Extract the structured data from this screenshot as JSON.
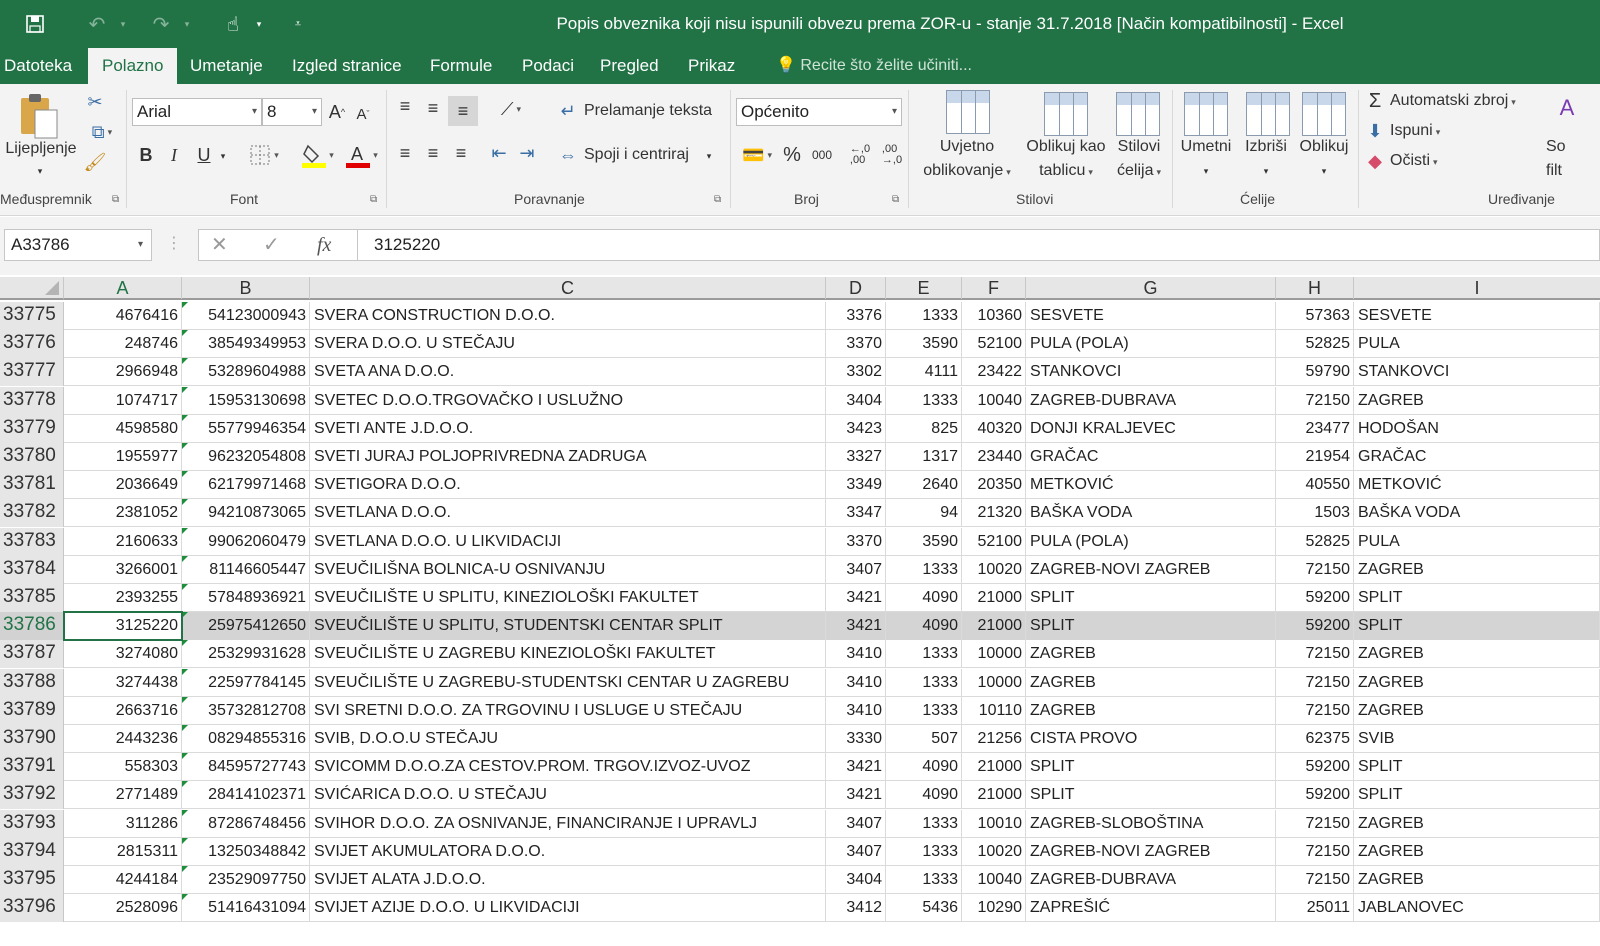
{
  "window": {
    "title": "Popis obveznika koji nisu ispunili obvezu prema ZOR-u - stanje 31.7.2018  [Način kompatibilnosti] - Excel"
  },
  "quick_access": {
    "icons": [
      "save-icon",
      "undo-icon",
      "redo-icon",
      "touch-mode-icon",
      "customize-icon"
    ]
  },
  "tabs": [
    "Datoteka",
    "Polazno",
    "Umetanje",
    "Izgled stranice",
    "Formule",
    "Podaci",
    "Pregled",
    "Prikaz"
  ],
  "active_tab": "Polazno",
  "tell_me": "Recite što želite učiniti...",
  "ribbon": {
    "clipboard": {
      "paste_label": "Lijepljenje",
      "group": "Međuspremnik"
    },
    "font": {
      "name": "Arial",
      "size": "8",
      "group": "Font",
      "bold": "B",
      "italic": "I",
      "underline": "U"
    },
    "alignment": {
      "wrap": "Prelamanje teksta",
      "merge": "Spoji i centriraj",
      "group": "Poravnanje"
    },
    "number": {
      "format": "Općenito",
      "percent": "%",
      "thousands": "000",
      "group": "Broj"
    },
    "styles": {
      "conditional_1": "Uvjetno",
      "conditional_2": "oblikovanje",
      "table_1": "Oblikuj kao",
      "table_2": "tablicu",
      "cell_1": "Stilovi",
      "cell_2": "ćelija",
      "group": "Stilovi"
    },
    "cells": {
      "insert": "Umetni",
      "delete": "Izbriši",
      "format": "Oblikuj",
      "group": "Ćelije"
    },
    "editing": {
      "autosum": "Automatski zbroj",
      "fill": "Ispuni",
      "clear": "Očisti",
      "sort_1": "So",
      "sort_2": "filt",
      "group": "Uređivanje"
    }
  },
  "formula_bar": {
    "name_box": "A33786",
    "value": "3125220",
    "fx": "fx"
  },
  "columns": [
    "A",
    "B",
    "C",
    "D",
    "E",
    "F",
    "G",
    "H",
    "I"
  ],
  "selected_row": "33786",
  "rows": [
    {
      "n": "33775",
      "a": "4676416",
      "b": "54123000943",
      "c": "SVERA CONSTRUCTION D.O.O.",
      "d": "3376",
      "e": "1333",
      "f": "10360",
      "g": "SESVETE",
      "h": "57363",
      "i": "SESVETE"
    },
    {
      "n": "33776",
      "a": "248746",
      "b": "38549349953",
      "c": "SVERA D.O.O. U STEČAJU",
      "d": "3370",
      "e": "3590",
      "f": "52100",
      "g": "PULA (POLA)",
      "h": "52825",
      "i": "PULA"
    },
    {
      "n": "33777",
      "a": "2966948",
      "b": "53289604988",
      "c": "SVETA ANA D.O.O.",
      "d": "3302",
      "e": "4111",
      "f": "23422",
      "g": "STANKOVCI",
      "h": "59790",
      "i": "STANKOVCI"
    },
    {
      "n": "33778",
      "a": "1074717",
      "b": "15953130698",
      "c": "SVETEC D.O.O.TRGOVAČKO I USLUŽNO",
      "d": "3404",
      "e": "1333",
      "f": "10040",
      "g": "ZAGREB-DUBRAVA",
      "h": "72150",
      "i": "ZAGREB"
    },
    {
      "n": "33779",
      "a": "4598580",
      "b": "55779946354",
      "c": "SVETI ANTE J.D.O.O.",
      "d": "3423",
      "e": "825",
      "f": "40320",
      "g": "DONJI KRALJEVEC",
      "h": "23477",
      "i": "HODOŠAN"
    },
    {
      "n": "33780",
      "a": "1955977",
      "b": "96232054808",
      "c": "SVETI JURAJ POLJOPRIVREDNA ZADRUGA",
      "d": "3327",
      "e": "1317",
      "f": "23440",
      "g": "GRAČAC",
      "h": "21954",
      "i": "GRAČAC"
    },
    {
      "n": "33781",
      "a": "2036649",
      "b": "62179971468",
      "c": "SVETIGORA D.O.O.",
      "d": "3349",
      "e": "2640",
      "f": "20350",
      "g": "METKOVIĆ",
      "h": "40550",
      "i": "METKOVIĆ"
    },
    {
      "n": "33782",
      "a": "2381052",
      "b": "94210873065",
      "c": "SVETLANA D.O.O.",
      "d": "3347",
      "e": "94",
      "f": "21320",
      "g": "BAŠKA VODA",
      "h": "1503",
      "i": "BAŠKA VODA"
    },
    {
      "n": "33783",
      "a": "2160633",
      "b": "99062060479",
      "c": "SVETLANA D.O.O. U LIKVIDACIJI",
      "d": "3370",
      "e": "3590",
      "f": "52100",
      "g": "PULA (POLA)",
      "h": "52825",
      "i": "PULA"
    },
    {
      "n": "33784",
      "a": "3266001",
      "b": "81146605447",
      "c": "SVEUČILIŠNA BOLNICA-U OSNIVANJU",
      "d": "3407",
      "e": "1333",
      "f": "10020",
      "g": "ZAGREB-NOVI ZAGREB",
      "h": "72150",
      "i": "ZAGREB"
    },
    {
      "n": "33785",
      "a": "2393255",
      "b": "57848936921",
      "c": "SVEUČILIŠTE U SPLITU, KINEZIOLOŠKI FAKULTET",
      "d": "3421",
      "e": "4090",
      "f": "21000",
      "g": "SPLIT",
      "h": "59200",
      "i": "SPLIT"
    },
    {
      "n": "33786",
      "a": "3125220",
      "b": "25975412650",
      "c": "SVEUČILIŠTE U SPLITU, STUDENTSKI CENTAR SPLIT",
      "d": "3421",
      "e": "4090",
      "f": "21000",
      "g": "SPLIT",
      "h": "59200",
      "i": "SPLIT"
    },
    {
      "n": "33787",
      "a": "3274080",
      "b": "25329931628",
      "c": "SVEUČILIŠTE U ZAGREBU KINEZIOLOŠKI FAKULTET",
      "d": "3410",
      "e": "1333",
      "f": "10000",
      "g": "ZAGREB",
      "h": "72150",
      "i": "ZAGREB"
    },
    {
      "n": "33788",
      "a": "3274438",
      "b": "22597784145",
      "c": "SVEUČILIŠTE U ZAGREBU-STUDENTSKI CENTAR U ZAGREBU",
      "d": "3410",
      "e": "1333",
      "f": "10000",
      "g": "ZAGREB",
      "h": "72150",
      "i": "ZAGREB"
    },
    {
      "n": "33789",
      "a": "2663716",
      "b": "35732812708",
      "c": "SVI SRETNI D.O.O. ZA TRGOVINU I USLUGE U STEČAJU",
      "d": "3410",
      "e": "1333",
      "f": "10110",
      "g": "ZAGREB",
      "h": "72150",
      "i": "ZAGREB"
    },
    {
      "n": "33790",
      "a": "2443236",
      "b": "08294855316",
      "c": "SVIB, D.O.O.U STEČAJU",
      "d": "3330",
      "e": "507",
      "f": "21256",
      "g": "CISTA PROVO",
      "h": "62375",
      "i": "SVIB"
    },
    {
      "n": "33791",
      "a": "558303",
      "b": "84595727743",
      "c": "SVICOMM D.O.O.ZA CESTOV.PROM. TRGOV.IZVOZ-UVOZ",
      "d": "3421",
      "e": "4090",
      "f": "21000",
      "g": "SPLIT",
      "h": "59200",
      "i": "SPLIT"
    },
    {
      "n": "33792",
      "a": "2771489",
      "b": "28414102371",
      "c": "SVIĆARICA D.O.O. U STEČAJU",
      "d": "3421",
      "e": "4090",
      "f": "21000",
      "g": "SPLIT",
      "h": "59200",
      "i": "SPLIT"
    },
    {
      "n": "33793",
      "a": "311286",
      "b": "87286748456",
      "c": "SVIHOR D.O.O. ZA OSNIVANJE, FINANCIRANJE I UPRAVLJ",
      "d": "3407",
      "e": "1333",
      "f": "10010",
      "g": "ZAGREB-SLOBOŠTINA",
      "h": "72150",
      "i": "ZAGREB"
    },
    {
      "n": "33794",
      "a": "2815311",
      "b": "13250348842",
      "c": "SVIJET AKUMULATORA D.O.O.",
      "d": "3407",
      "e": "1333",
      "f": "10020",
      "g": "ZAGREB-NOVI ZAGREB",
      "h": "72150",
      "i": "ZAGREB"
    },
    {
      "n": "33795",
      "a": "4244184",
      "b": "23529097750",
      "c": "SVIJET ALATA J.D.O.O.",
      "d": "3404",
      "e": "1333",
      "f": "10040",
      "g": "ZAGREB-DUBRAVA",
      "h": "72150",
      "i": "ZAGREB"
    },
    {
      "n": "33796",
      "a": "2528096",
      "b": "51416431094",
      "c": "SVIJET AZIJE D.O.O. U LIKVIDACIJI",
      "d": "3412",
      "e": "5436",
      "f": "10290",
      "g": "ZAPREŠIĆ",
      "h": "25011",
      "i": "JABLANOVEC"
    }
  ]
}
